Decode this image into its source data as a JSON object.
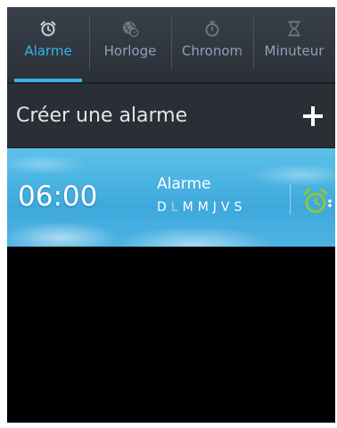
{
  "tabs": [
    {
      "label": "Alarme",
      "icon": "alarm-clock-icon",
      "active": true
    },
    {
      "label": "Horloge",
      "icon": "world-clock-icon",
      "active": false
    },
    {
      "label": "Chronom",
      "icon": "stopwatch-icon",
      "active": false
    },
    {
      "label": "Minuteur",
      "icon": "hourglass-icon",
      "active": false
    }
  ],
  "create": {
    "label": "Créer une alarme",
    "icon": "plus-icon"
  },
  "alarm": {
    "time": "06:00",
    "name": "Alarme",
    "days": [
      "D",
      "L",
      "M",
      "M",
      "J",
      "V",
      "S"
    ],
    "active_days": [
      false,
      false,
      true,
      true,
      true,
      true,
      true
    ],
    "toggle_icon": "alarm-on-icon"
  },
  "colors": {
    "accent": "#36b3ea",
    "alarm_green": "#8cc63f",
    "card_blue": "#4fb4e4"
  }
}
